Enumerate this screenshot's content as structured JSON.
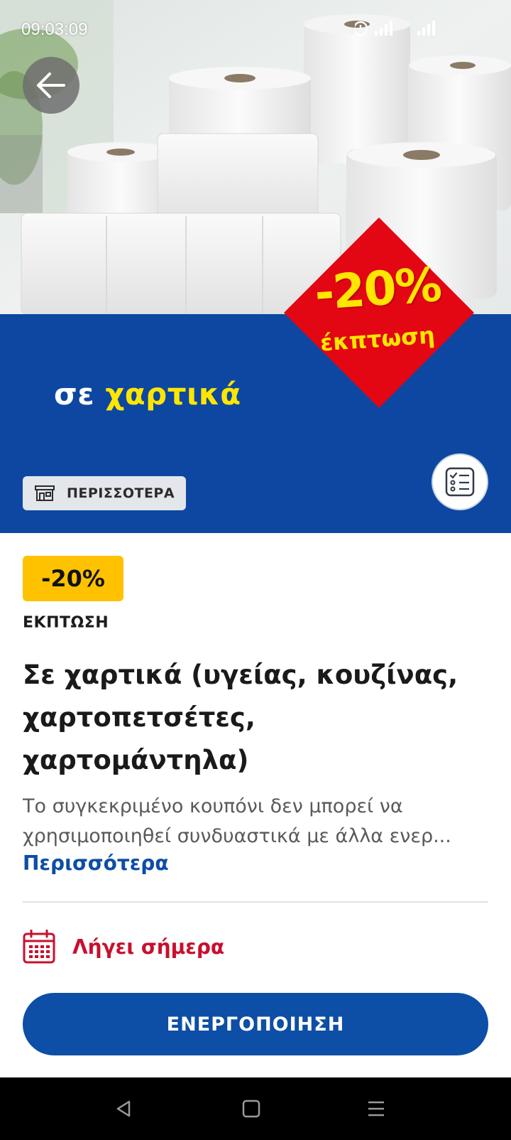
{
  "status_bar": {
    "time": "09:03:09"
  },
  "hero": {
    "caption_prefix": "σε",
    "caption_highlight": "χαρτικά",
    "badge_percent": "-20%",
    "badge_word": "έκπτωση",
    "more_chip_label": "ΠΕΡΙΣΣΟΤΕΡΑ",
    "colors": {
      "band": "#0d47a1",
      "badge": "#e30613",
      "highlight": "#ffe600"
    }
  },
  "offer": {
    "discount": "-20%",
    "type": "ΕΚΠΤΩΣΗ",
    "title": "Σε χαρτικά (υγείας, κουζίνας, χαρτοπετσέτες, χαρτομάντηλα)",
    "description_line1": "Το συγκεκριμένο κουπόνι δεν μπορεί να",
    "description_line2": "χρησιμοποιηθεί συνδυαστικά με άλλα ενερ...",
    "more_link": "Περισσότερα",
    "expiry": "Λήγει σήμερα",
    "activate_label": "ΕΝΕΡΓΟΠΟΙΗΣΗ",
    "colors": {
      "pill": "#ffc200",
      "expiry": "#c8102e",
      "button": "#0d4ea6"
    }
  },
  "icons": {
    "back": "arrow-left-icon",
    "chip": "store-icon",
    "list": "checklist-icon",
    "expiry": "calendar-icon",
    "nav_back": "triangle-back-icon",
    "nav_home": "square-home-icon",
    "nav_menu": "menu-lines-icon"
  }
}
